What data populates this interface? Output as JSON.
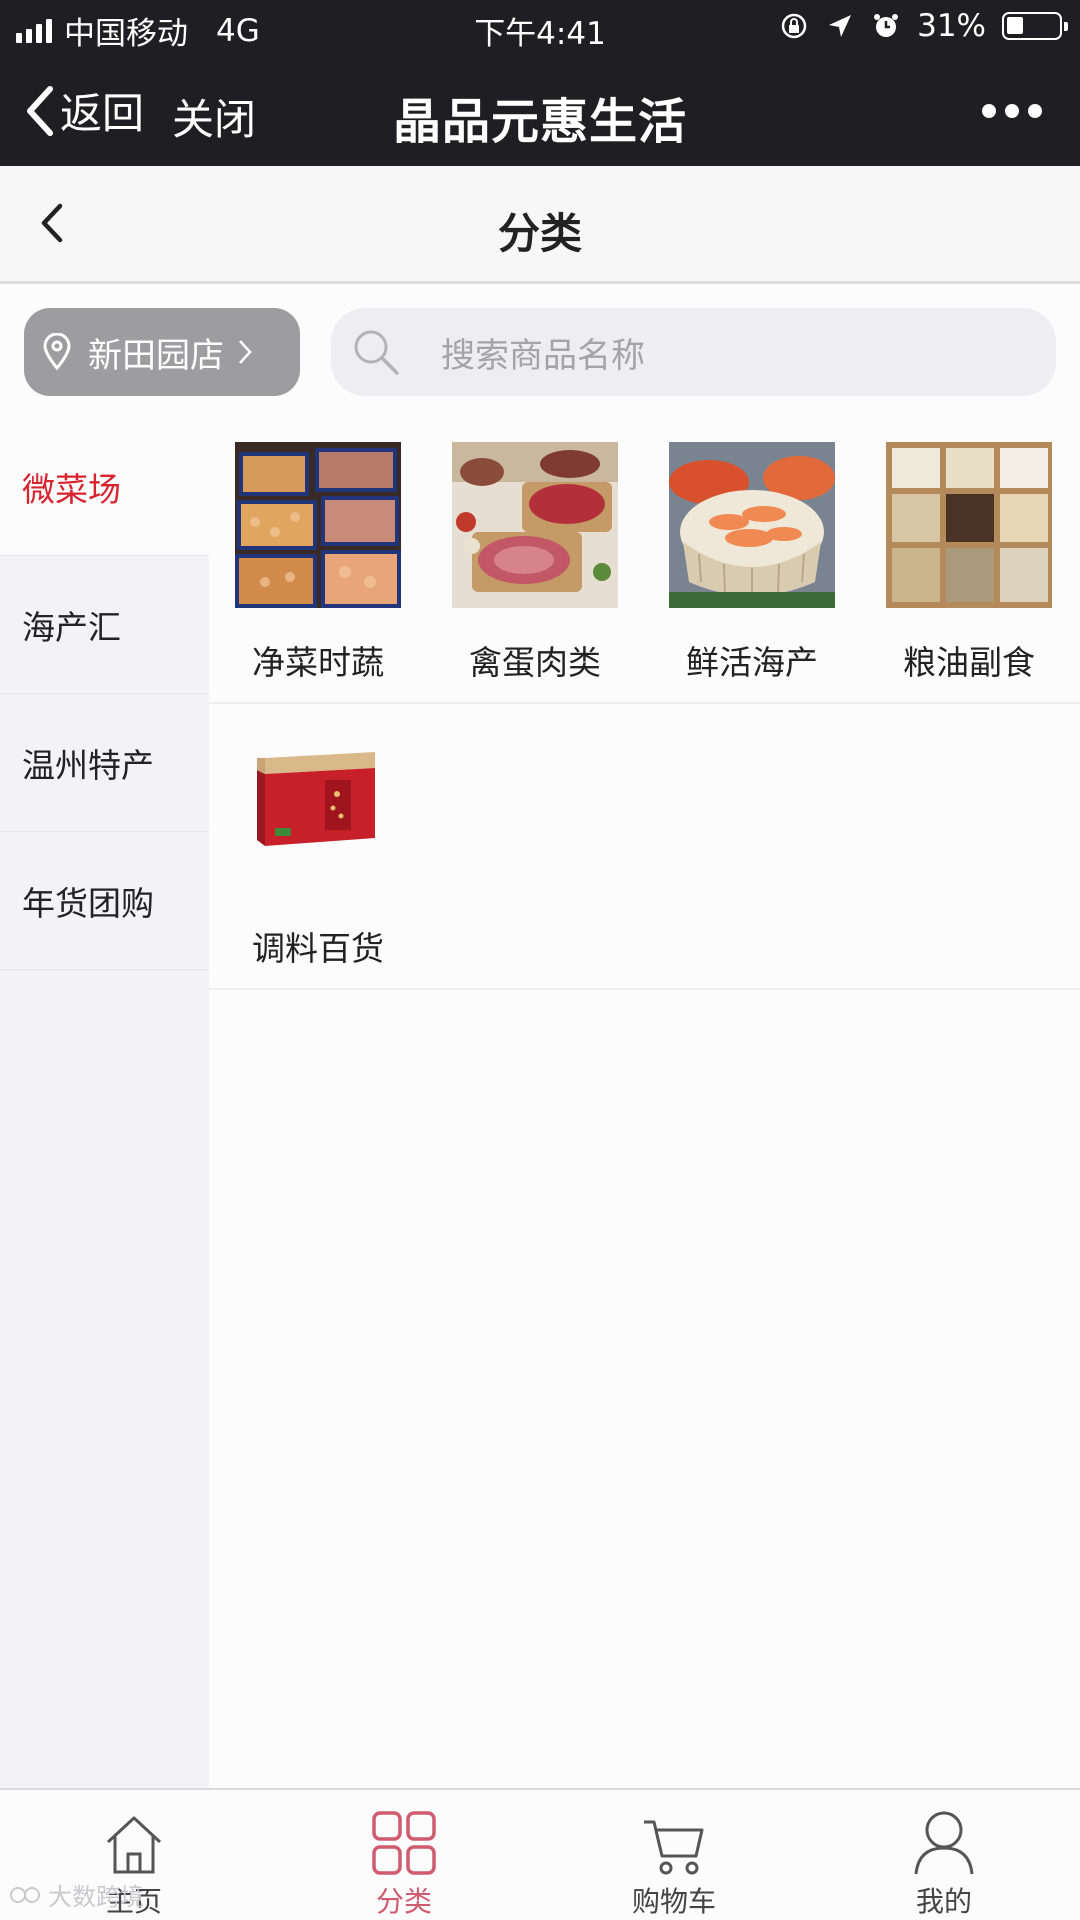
{
  "status_bar": {
    "carrier": "中国移动",
    "network": "4G",
    "time": "下午4:41",
    "battery": "31%",
    "battery_level": 0.31
  },
  "wechat_bar": {
    "back_label": "返回",
    "close_label": "关闭",
    "title": "晶品元惠生活"
  },
  "page_header": {
    "title": "分类"
  },
  "store": {
    "name": "新田园店"
  },
  "search": {
    "placeholder": "搜索商品名称"
  },
  "sidebar": {
    "items": [
      {
        "label": "微菜场",
        "active": true
      },
      {
        "label": "海产汇",
        "active": false
      },
      {
        "label": "温州特产",
        "active": false
      },
      {
        "label": "年货团购",
        "active": false
      }
    ]
  },
  "categories": [
    {
      "label": "净菜时蔬",
      "image": "seafood-tray-image"
    },
    {
      "label": "禽蛋肉类",
      "image": "meat-image"
    },
    {
      "label": "鲜活海产",
      "image": "shrimp-basket-image"
    },
    {
      "label": "粮油副食",
      "image": "grains-box-image"
    },
    {
      "label": "调料百货",
      "image": "gift-box-image"
    }
  ],
  "tabbar": {
    "items": [
      {
        "label": "主页",
        "icon": "home-icon",
        "active": false
      },
      {
        "label": "分类",
        "icon": "grid-icon",
        "active": true
      },
      {
        "label": "购物车",
        "icon": "cart-icon",
        "active": false
      },
      {
        "label": "我的",
        "icon": "user-icon",
        "active": false
      }
    ]
  },
  "watermark": "大数跨境",
  "colors": {
    "dark_bar": "#1f1e22",
    "active_red": "#d8242f",
    "active_tab": "#d05a6e",
    "store_button": "#9d9d9f"
  }
}
